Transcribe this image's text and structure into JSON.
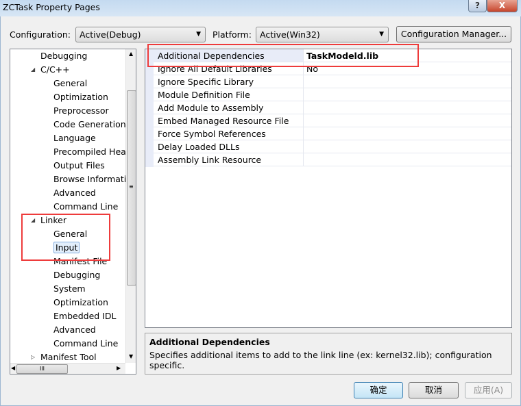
{
  "window": {
    "title": "ZCTask Property Pages",
    "help": "?",
    "close": "X"
  },
  "toolbar": {
    "configuration_label": "Configuration:",
    "configuration_value": "Active(Debug)",
    "platform_label": "Platform:",
    "platform_value": "Active(Win32)",
    "config_manager": "Configuration Manager..."
  },
  "tree": {
    "items": [
      {
        "label": "Debugging",
        "level": 1
      },
      {
        "label": "C/C++",
        "level": 1,
        "expanded": true
      },
      {
        "label": "General",
        "level": 2
      },
      {
        "label": "Optimization",
        "level": 2
      },
      {
        "label": "Preprocessor",
        "level": 2
      },
      {
        "label": "Code Generation",
        "level": 2
      },
      {
        "label": "Language",
        "level": 2
      },
      {
        "label": "Precompiled Headers",
        "level": 2
      },
      {
        "label": "Output Files",
        "level": 2
      },
      {
        "label": "Browse Information",
        "level": 2
      },
      {
        "label": "Advanced",
        "level": 2
      },
      {
        "label": "Command Line",
        "level": 2
      },
      {
        "label": "Linker",
        "level": 1,
        "expanded": true
      },
      {
        "label": "General",
        "level": 2
      },
      {
        "label": "Input",
        "level": 2,
        "selected": true
      },
      {
        "label": "Manifest File",
        "level": 2
      },
      {
        "label": "Debugging",
        "level": 2
      },
      {
        "label": "System",
        "level": 2
      },
      {
        "label": "Optimization",
        "level": 2
      },
      {
        "label": "Embedded IDL",
        "level": 2
      },
      {
        "label": "Advanced",
        "level": 2
      },
      {
        "label": "Command Line",
        "level": 2
      },
      {
        "label": "Manifest Tool",
        "level": 1,
        "expanded": false
      }
    ]
  },
  "grid": {
    "rows": [
      {
        "name": "Additional Dependencies",
        "value": "TaskModeld.lib",
        "bold": true
      },
      {
        "name": "Ignore All Default Libraries",
        "value": "No"
      },
      {
        "name": "Ignore Specific Library",
        "value": ""
      },
      {
        "name": "Module Definition File",
        "value": ""
      },
      {
        "name": "Add Module to Assembly",
        "value": ""
      },
      {
        "name": "Embed Managed Resource File",
        "value": ""
      },
      {
        "name": "Force Symbol References",
        "value": ""
      },
      {
        "name": "Delay Loaded DLLs",
        "value": ""
      },
      {
        "name": "Assembly Link Resource",
        "value": ""
      }
    ]
  },
  "description": {
    "title": "Additional Dependencies",
    "text": "Specifies additional items to add to the link line (ex: kernel32.lib); configuration specific."
  },
  "buttons": {
    "ok": "确定",
    "cancel": "取消",
    "apply": "应用(A)"
  },
  "colors": {
    "highlight_box": "#ee3b3b",
    "selection": "#e2eefb"
  }
}
